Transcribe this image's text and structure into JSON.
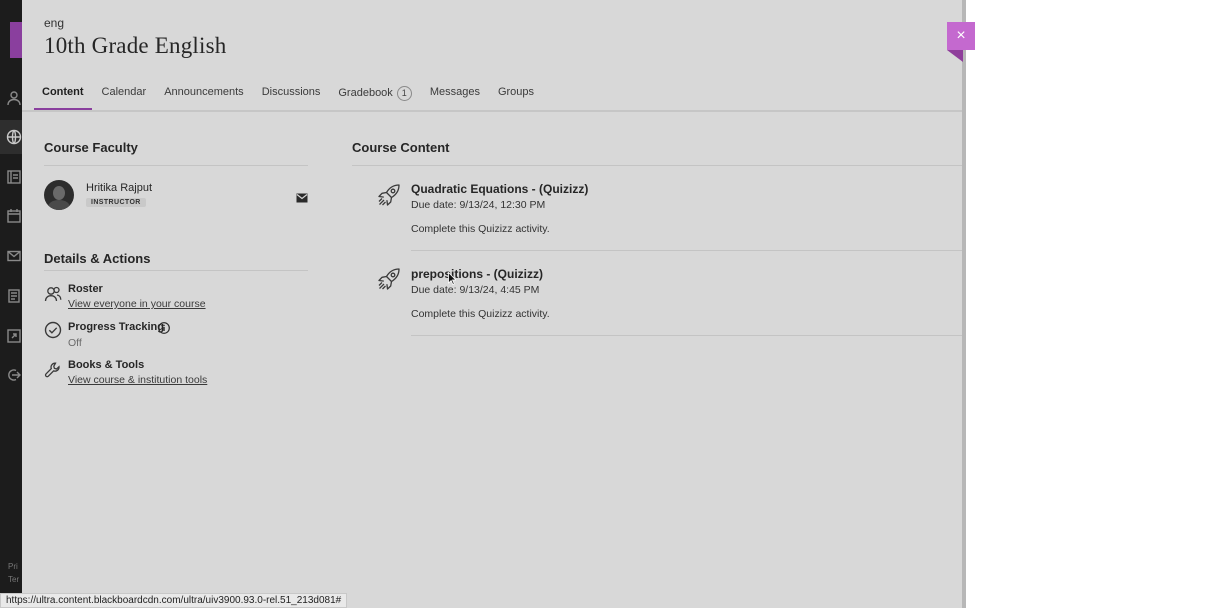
{
  "course": {
    "code": "eng",
    "title": "10th Grade English"
  },
  "tabs": [
    {
      "label": "Content"
    },
    {
      "label": "Calendar"
    },
    {
      "label": "Announcements"
    },
    {
      "label": "Discussions"
    },
    {
      "label": "Gradebook",
      "badge": "1"
    },
    {
      "label": "Messages"
    },
    {
      "label": "Groups"
    }
  ],
  "faculty": {
    "heading": "Course Faculty",
    "name": "Hritika Rajput",
    "role": "INSTRUCTOR",
    "mail_icon": "envelope-icon"
  },
  "details": {
    "heading": "Details & Actions",
    "roster": {
      "title": "Roster",
      "link": "View everyone in your course",
      "icon": "people-icon"
    },
    "progress": {
      "title": "Progress Tracking",
      "sub": "Off",
      "icon": "check-circle-icon",
      "info_icon": "info-icon"
    },
    "books": {
      "title": "Books & Tools",
      "link": "View course & institution tools",
      "icon": "wrench-icon"
    }
  },
  "content": {
    "heading": "Course Content",
    "items": [
      {
        "title": "Quadratic Equations - (Quizizz)",
        "due": "Due date: 9/13/24, 12:30 PM",
        "desc": "Complete this Quizizz activity.",
        "icon": "rocket-icon"
      },
      {
        "title": "prepositions - (Quizizz)",
        "due": "Due date: 9/13/24, 4:45 PM",
        "desc": "Complete this Quizizz activity.",
        "icon": "rocket-icon"
      }
    ]
  },
  "rail_footer": {
    "line1": "Pri",
    "line2": "Ter"
  },
  "close_label": "×",
  "status_url": "https://ultra.content.blackboardcdn.com/ultra/uiv3900.93.0-rel.51_213d081#",
  "colors": {
    "accent": "#8a3f9e",
    "close_bg": "#c469cf",
    "panel_bg": "#d8d8d8",
    "rail_bg": "#1c1c1c"
  }
}
